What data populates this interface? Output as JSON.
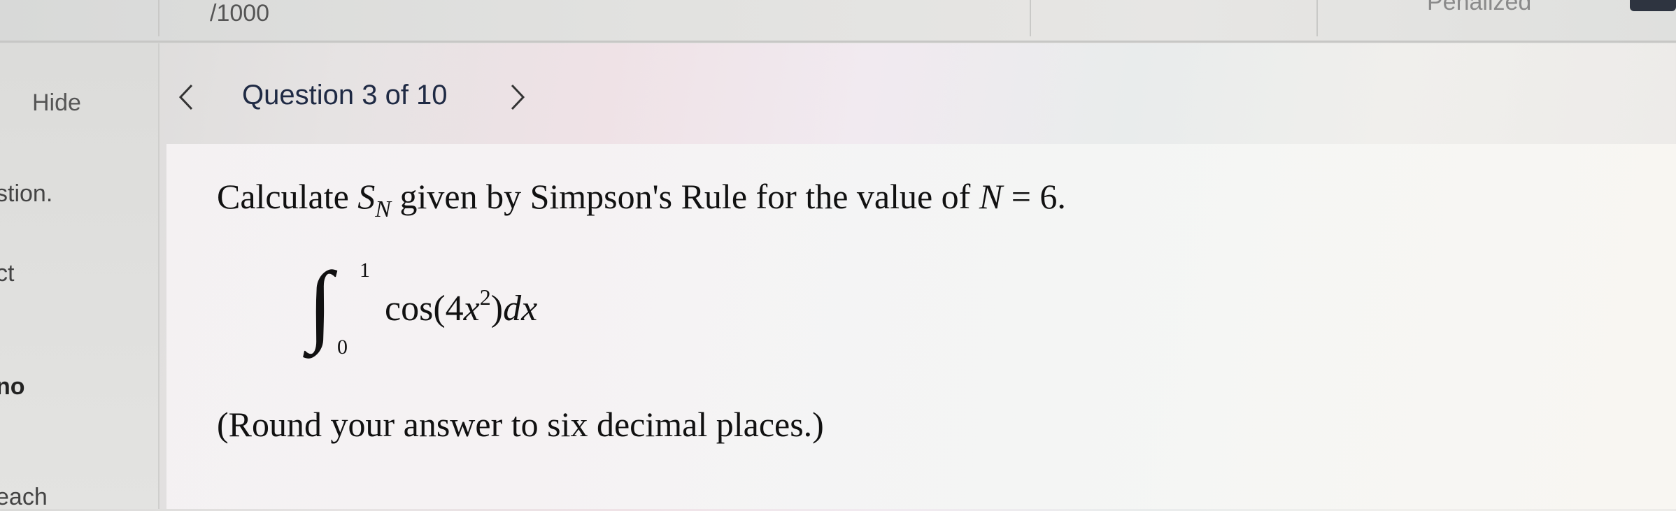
{
  "header": {
    "points": "/1000",
    "penalized": "Penalized"
  },
  "sidebar": {
    "hide": "Hide",
    "fragments": [
      "stion.",
      "ct",
      "no",
      "each"
    ]
  },
  "question_nav": {
    "title": "Question 3 of 10"
  },
  "question": {
    "prompt_start": "Calculate ",
    "prompt_S": "S",
    "prompt_sub": "N",
    "prompt_mid": " given by Simpson's Rule for the value of ",
    "prompt_N": "N",
    "prompt_end": " = 6.",
    "integral": {
      "upper": "1",
      "lower": "0",
      "func": "cos",
      "arg_open": "(4",
      "var": "x",
      "power": "2",
      "arg_close": ")",
      "dx": "dx"
    },
    "rounding": "(Round your answer to six decimal places.)"
  }
}
